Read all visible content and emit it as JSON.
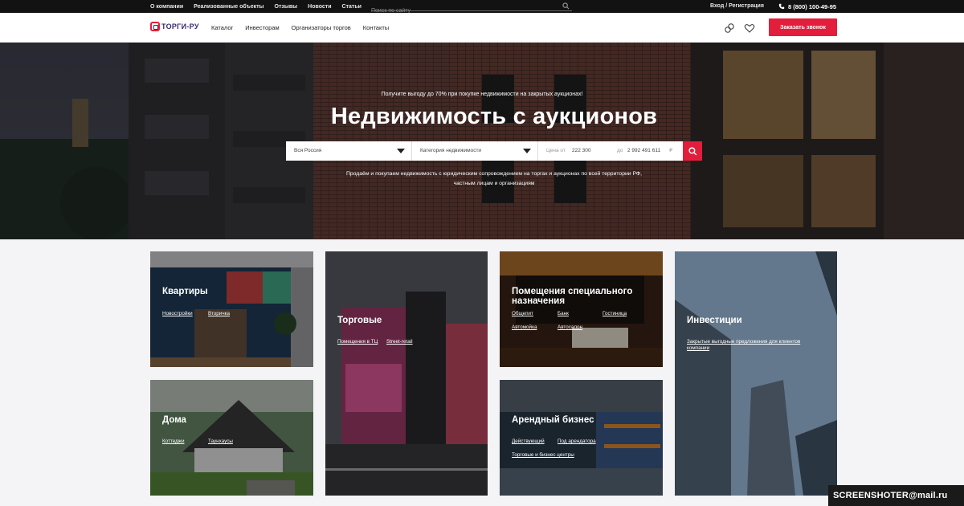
{
  "topbar": {
    "links": [
      "О компании",
      "Реализованные объекты",
      "Отзывы",
      "Новости",
      "Статьи"
    ],
    "search_placeholder": "Поиск по сайту",
    "login": "Вход / Регистрация",
    "phone": "8 (800) 100-49-95"
  },
  "header": {
    "logo_text": "ТОРГИ-РУ",
    "nav": [
      "Каталог",
      "Инвесторам",
      "Организаторы торгов",
      "Контакты"
    ],
    "cta_label": "Заказать звонок"
  },
  "hero": {
    "promo": "Получите выгоду до 70% при покупке недвижимости на закрытых аукционах!",
    "title": "Недвижимость с аукционов",
    "region": "Вся Россия",
    "category": "Категория недвижимости",
    "price_from_label": "Цена от",
    "price_from": "222 300",
    "price_to_label": "до",
    "price_to": "2 992 491 611",
    "currency": "₽",
    "desc_line1": "Продаём и покупаем недвижимость с юридическим сопровождением на торгах и аукционах по всей территории РФ,",
    "desc_line2": "частным лицам и организациям"
  },
  "cards": {
    "apartments": {
      "title": "Квартиры",
      "links": [
        "Новостройки",
        "Вторичка"
      ]
    },
    "retail": {
      "title": "Торговые",
      "links": [
        "Помещения в ТЦ",
        "Street-retail"
      ]
    },
    "special": {
      "title_line1": "Помещения специального",
      "title_line2": "назначения",
      "links": [
        "Общепит",
        "Банк",
        "Гостиница",
        "Автомойка",
        "Автосалон"
      ]
    },
    "investments": {
      "title": "Инвестиции",
      "links": [
        "Закрытые выгодные предложения для клиентов компании"
      ]
    },
    "houses": {
      "title": "Дома",
      "links": [
        "Коттеджи",
        "Таунхаусы"
      ]
    },
    "rental": {
      "title": "Арендный бизнес",
      "links": [
        "Действующий",
        "Под арендатора",
        "Торговые и бизнес центры"
      ]
    }
  },
  "watermark": "SCREENSHOTER@mail.ru"
}
